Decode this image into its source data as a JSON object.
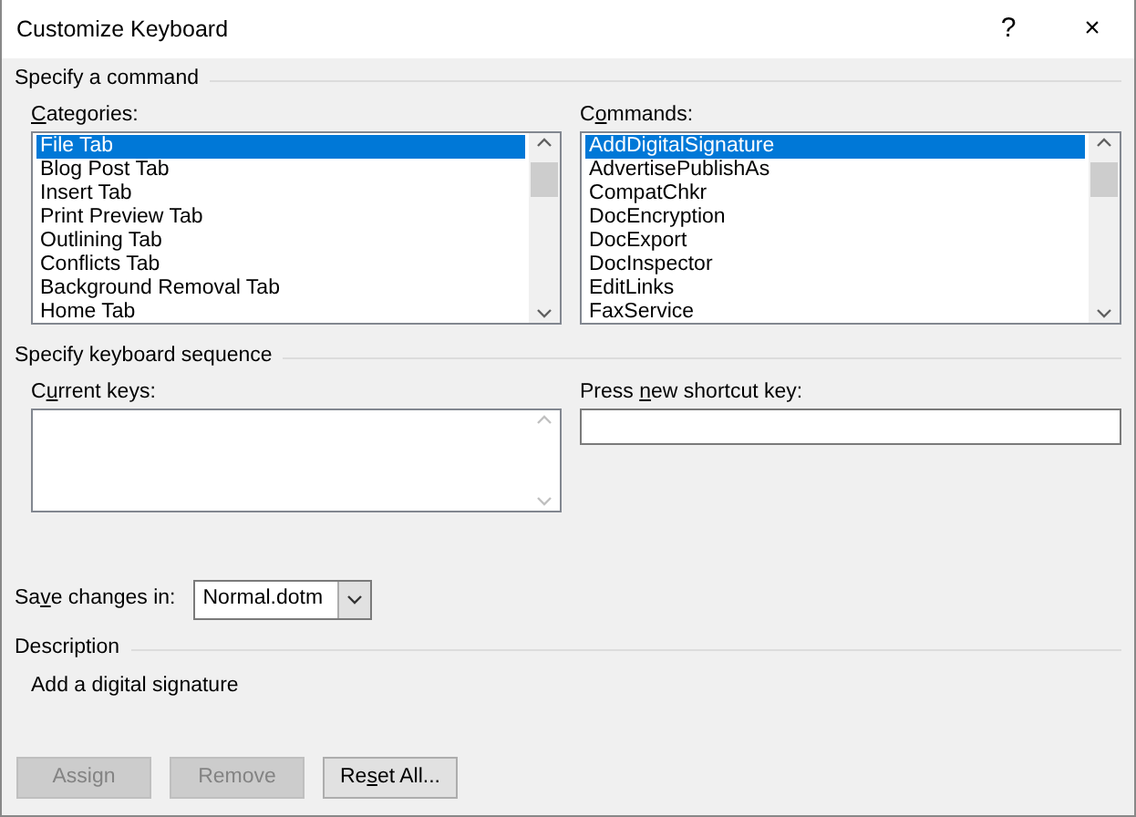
{
  "window": {
    "title": "Customize Keyboard",
    "help": "?",
    "close": "×"
  },
  "command_section": {
    "title": "Specify a command",
    "categories": {
      "label": {
        "key": "C",
        "after": "ategories:"
      },
      "items": [
        {
          "text": "File Tab",
          "selected": true
        },
        {
          "text": "Blog Post Tab",
          "selected": false
        },
        {
          "text": "Insert Tab",
          "selected": false
        },
        {
          "text": "Print Preview Tab",
          "selected": false
        },
        {
          "text": "Outlining Tab",
          "selected": false
        },
        {
          "text": "Conflicts Tab",
          "selected": false
        },
        {
          "text": "Background Removal Tab",
          "selected": false
        },
        {
          "text": "Home Tab",
          "selected": false
        }
      ]
    },
    "commands": {
      "label": {
        "before": "C",
        "key": "o",
        "after": "mmands:"
      },
      "items": [
        {
          "text": "AddDigitalSignature",
          "selected": true
        },
        {
          "text": "AdvertisePublishAs",
          "selected": false
        },
        {
          "text": "CompatChkr",
          "selected": false
        },
        {
          "text": "DocEncryption",
          "selected": false
        },
        {
          "text": "DocExport",
          "selected": false
        },
        {
          "text": "DocInspector",
          "selected": false
        },
        {
          "text": "EditLinks",
          "selected": false
        },
        {
          "text": "FaxService",
          "selected": false
        }
      ]
    }
  },
  "keyboard_section": {
    "title": "Specify keyboard sequence",
    "current_keys": {
      "label": {
        "before": "C",
        "key": "u",
        "after": "rrent keys:"
      }
    },
    "new_shortcut": {
      "label": {
        "before": "Press ",
        "key": "n",
        "after": "ew shortcut key:"
      }
    }
  },
  "save_changes": {
    "label": {
      "before": "Sa",
      "key": "v",
      "after": "e changes in:"
    },
    "value": "Normal.dotm"
  },
  "description": {
    "title": "Description",
    "text": "Add a digital signature"
  },
  "buttons": [
    {
      "label": {
        "before": "Assign"
      },
      "disabled": true
    },
    {
      "label": {
        "before": "Remove"
      },
      "disabled": true
    },
    {
      "label": {
        "before": "Re",
        "key": "s",
        "after": "et All..."
      },
      "disabled": false
    }
  ]
}
